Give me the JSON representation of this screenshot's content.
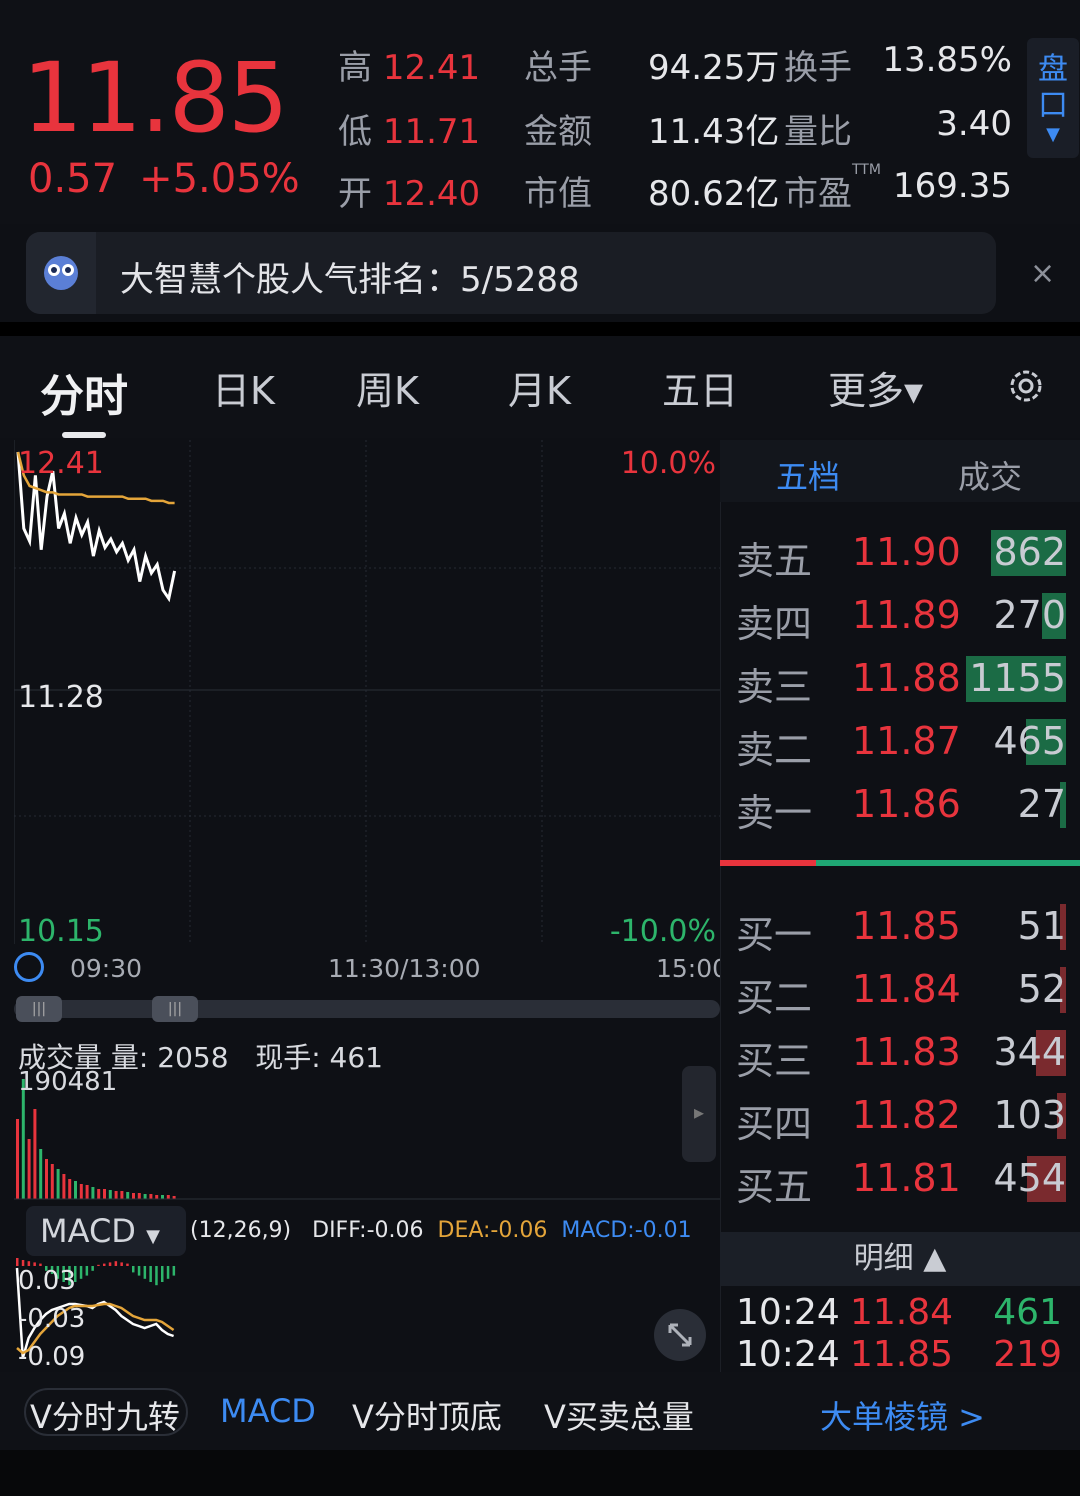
{
  "quote": {
    "price": "11.85",
    "change": "0.57",
    "change_pct": "+5.05%",
    "high_label": "高",
    "high": "12.41",
    "low_label": "低",
    "low": "11.71",
    "open_label": "开",
    "open": "12.40",
    "total_hands_label": "总手",
    "total_hands": "94.25万",
    "amount_label": "金额",
    "amount": "11.43亿",
    "mcap_label": "市值",
    "mcap": "80.62亿",
    "turnover_label": "换手",
    "turnover": "13.85%",
    "vol_ratio_label": "量比",
    "vol_ratio": "3.40",
    "pe_label": "市盈",
    "pe_superscript": "TTM",
    "pe": "169.35",
    "pankou_label_1": "盘",
    "pankou_label_2": "口"
  },
  "banner": {
    "text": "大智慧个股人气排名：5/5288",
    "close": "×"
  },
  "tabs": [
    {
      "label": "分时"
    },
    {
      "label": "日K"
    },
    {
      "label": "周K"
    },
    {
      "label": "月K"
    },
    {
      "label": "五日"
    },
    {
      "label": "更多▾"
    }
  ],
  "chart": {
    "high_label": "12.41",
    "mid_label": "11.28",
    "low_label": "10.15",
    "pct_top": "10.0%",
    "pct_bottom": "-10.0%",
    "t_start": "09:30",
    "t_mid": "11:30/13:00",
    "t_end": "15:00",
    "colors": {
      "price": "#ffffff",
      "avg": "#e4a53a",
      "up": "#e8343d",
      "down": "#2db56b"
    }
  },
  "chart_data": {
    "type": "line",
    "ylim": [
      10.15,
      12.41
    ],
    "series": [
      {
        "values": [
          12.41,
          12.05,
          11.99,
          12.3,
          11.95,
          12.2,
          12.32,
          12.05,
          12.12,
          11.98,
          12.1,
          12.02,
          12.08,
          11.92,
          12.04,
          11.96,
          12.0,
          11.94,
          11.98,
          11.9,
          11.95,
          11.8,
          11.92,
          11.84,
          11.88,
          11.76,
          11.72,
          11.85
        ]
      },
      {
        "values": [
          12.41,
          12.3,
          12.25,
          12.24,
          12.23,
          12.22,
          12.22,
          12.21,
          12.21,
          12.21,
          12.21,
          12.21,
          12.2,
          12.2,
          12.2,
          12.2,
          12.2,
          12.2,
          12.2,
          12.19,
          12.19,
          12.19,
          12.19,
          12.18,
          12.18,
          12.18,
          12.17,
          12.17
        ]
      }
    ]
  },
  "volume": {
    "label": "成交量",
    "vol_label": "量: 2058",
    "cur_label": "现手: 461",
    "max": "190481"
  },
  "macd": {
    "selector": "MACD",
    "params": "(12,26,9)",
    "diff": "DIFF:-0.06",
    "dea": "DEA:-0.06",
    "macd": "MACD:-0.01",
    "y_top": "0.03",
    "y_mid": "-0.03",
    "y_bot": "-0.09"
  },
  "orderbook": {
    "tab_active": "五档",
    "tab_other": "成交",
    "asks": [
      {
        "label": "卖五",
        "price": "11.90",
        "vol": "862",
        "fill": 0.75
      },
      {
        "label": "卖四",
        "price": "11.89",
        "vol": "270",
        "fill": 0.24
      },
      {
        "label": "卖三",
        "price": "11.88",
        "vol": "1155",
        "fill": 1.0
      },
      {
        "label": "卖二",
        "price": "11.87",
        "vol": "465",
        "fill": 0.4
      },
      {
        "label": "卖一",
        "price": "11.86",
        "vol": "27",
        "fill": 0.03
      }
    ],
    "bids": [
      {
        "label": "买一",
        "price": "11.85",
        "vol": "51",
        "fill": 0.04
      },
      {
        "label": "买二",
        "price": "11.84",
        "vol": "52",
        "fill": 0.05
      },
      {
        "label": "买三",
        "price": "11.83",
        "vol": "344",
        "fill": 0.3
      },
      {
        "label": "买四",
        "price": "11.82",
        "vol": "103",
        "fill": 0.09
      },
      {
        "label": "买五",
        "price": "11.81",
        "vol": "454",
        "fill": 0.39
      }
    ],
    "detail_label": "明细 ▲",
    "details": [
      {
        "time": "10:24",
        "price": "11.84",
        "vol": "461"
      },
      {
        "time": "10:24",
        "price": "11.85",
        "vol": "219"
      }
    ]
  },
  "bottombar": {
    "item1": "V分时九转",
    "item2": "MACD",
    "item3": "V分时顶底",
    "item4": "V买卖总量",
    "item5": "大单棱镜 >"
  }
}
